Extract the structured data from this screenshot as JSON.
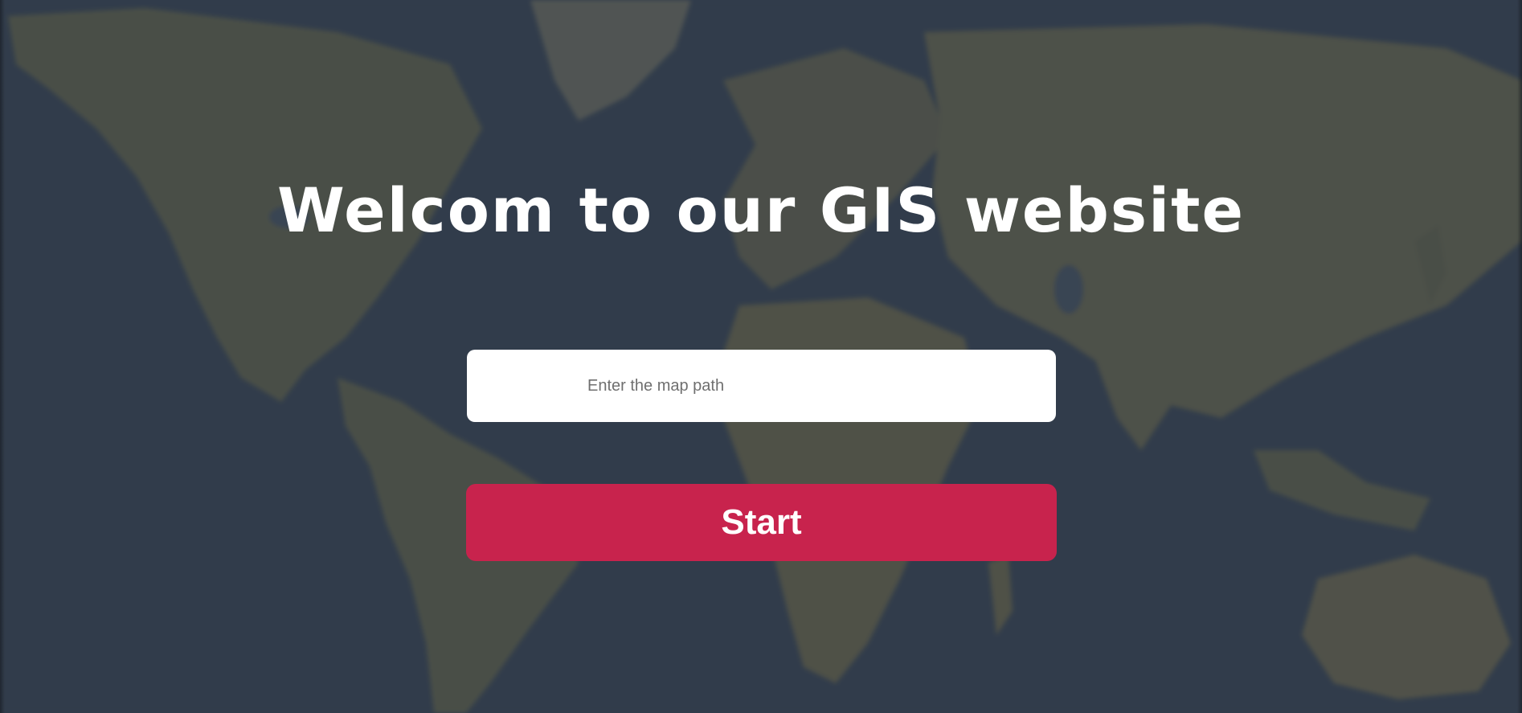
{
  "page": {
    "heading": "Welcom to our GIS website",
    "background": "world-map-image"
  },
  "form": {
    "map_path_placeholder": "Enter the map path",
    "map_path_value": "",
    "start_label": "Start"
  },
  "colors": {
    "overlay": "#34404f",
    "land": "#5a5e4c",
    "accent": "#c8234d",
    "text": "#ffffff"
  }
}
